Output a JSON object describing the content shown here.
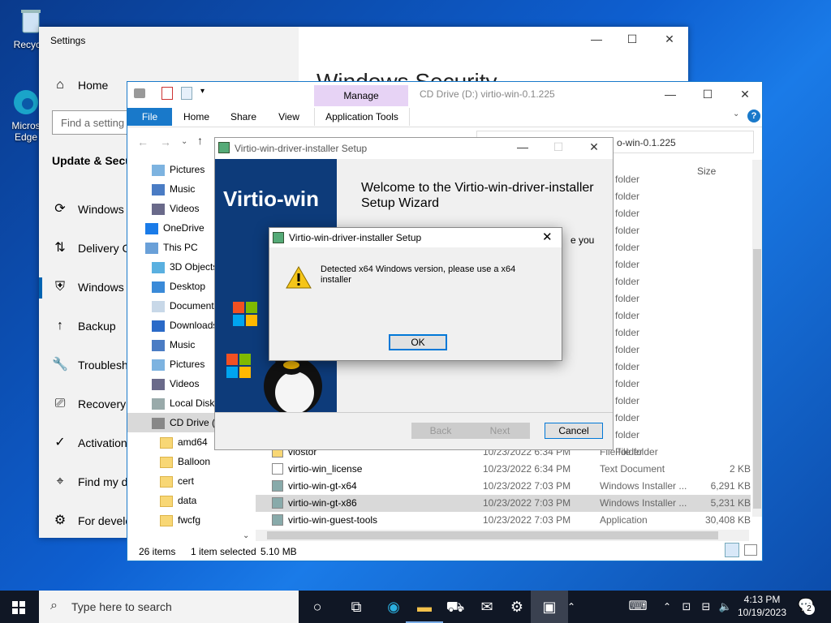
{
  "desktop": {
    "icons": [
      {
        "label": "Recycle"
      },
      {
        "label": "Micros Edge"
      }
    ]
  },
  "settings": {
    "window_title": "Settings",
    "search_placeholder": "Find a setting",
    "section_title": "Update & Secu",
    "home_label": "Home",
    "header_partial": "Windows Security",
    "nav": [
      {
        "icon": "sync-icon",
        "label": "Windows"
      },
      {
        "icon": "delivery-icon",
        "label": "Delivery C"
      },
      {
        "icon": "shield-icon",
        "label": "Windows"
      },
      {
        "icon": "backup-icon",
        "label": "Backup"
      },
      {
        "icon": "wrench-icon",
        "label": "Troublesh"
      },
      {
        "icon": "recovery-icon",
        "label": "Recovery"
      },
      {
        "icon": "check-circle-icon",
        "label": "Activation"
      },
      {
        "icon": "find-device-icon",
        "label": "Find my d"
      },
      {
        "icon": "developer-icon",
        "label": "For develo"
      }
    ]
  },
  "explorer": {
    "title": "CD Drive (D:) virtio-win-0.1.225",
    "manage_label": "Manage",
    "tabs": [
      "File",
      "Home",
      "Share",
      "View",
      "Application Tools"
    ],
    "address_tail": "o-win-0.1.225",
    "columns": {
      "size": "Size"
    },
    "tree": [
      {
        "icon": "pictures-icon",
        "label": "Pictures",
        "indent": 1
      },
      {
        "icon": "music-icon",
        "label": "Music",
        "indent": 1
      },
      {
        "icon": "videos-icon",
        "label": "Videos",
        "indent": 1
      },
      {
        "icon": "onedrive-icon",
        "label": "OneDrive",
        "indent": 0
      },
      {
        "icon": "thispc-icon",
        "label": "This PC",
        "indent": 0
      },
      {
        "icon": "3dobjects-icon",
        "label": "3D Objects",
        "indent": 1
      },
      {
        "icon": "desktop-icon",
        "label": "Desktop",
        "indent": 1
      },
      {
        "icon": "documents-icon",
        "label": "Documents",
        "indent": 1
      },
      {
        "icon": "downloads-icon",
        "label": "Downloads",
        "indent": 1
      },
      {
        "icon": "music-icon",
        "label": "Music",
        "indent": 1
      },
      {
        "icon": "pictures-icon",
        "label": "Pictures",
        "indent": 1
      },
      {
        "icon": "videos-icon",
        "label": "Videos",
        "indent": 1
      },
      {
        "icon": "localdisk-icon",
        "label": "Local Disk",
        "indent": 1
      },
      {
        "icon": "cddrive-icon",
        "label": "CD Drive (D",
        "indent": 1
      },
      {
        "icon": "folder-icon",
        "label": "amd64",
        "indent": 2
      },
      {
        "icon": "folder-icon",
        "label": "Balloon",
        "indent": 2
      },
      {
        "icon": "folder-icon",
        "label": "cert",
        "indent": 2
      },
      {
        "icon": "folder-icon",
        "label": "data",
        "indent": 2
      },
      {
        "icon": "folder-icon",
        "label": "fwcfg",
        "indent": 2
      }
    ],
    "folder_rows": [
      "folder",
      "folder",
      "folder",
      "folder",
      "folder",
      "folder",
      "folder",
      "folder",
      "folder",
      "folder",
      "folder",
      "folder",
      "folder",
      "folder",
      "folder",
      "folder",
      "File folder"
    ],
    "files": [
      {
        "name": "vlostor",
        "date": "10/23/2022 6:34 PM",
        "type": "File folder",
        "size": "",
        "icon": "folder-icon"
      },
      {
        "name": "virtio-win_license",
        "date": "10/23/2022 6:34 PM",
        "type": "Text Document",
        "size": "2 KB",
        "icon": "text-file-icon"
      },
      {
        "name": "virtio-win-gt-x64",
        "date": "10/23/2022 7:03 PM",
        "type": "Windows Installer ...",
        "size": "6,291 KB",
        "icon": "installer-icon"
      },
      {
        "name": "virtio-win-gt-x86",
        "date": "10/23/2022 7:03 PM",
        "type": "Windows Installer ...",
        "size": "5,231 KB",
        "icon": "installer-icon"
      },
      {
        "name": "virtio-win-guest-tools",
        "date": "10/23/2022 7:03 PM",
        "type": "Application",
        "size": "30,408 KB",
        "icon": "app-icon"
      }
    ],
    "status": {
      "items": "26 items",
      "selected": "1 item selected",
      "size": "5.10 MB"
    }
  },
  "installer": {
    "title": "Virtio-win-driver-installer Setup",
    "banner_text": "Virtio-win",
    "heading": "Welcome to the Virtio-win-driver-installer Setup Wizard",
    "body_partial": "e you",
    "back": "Back",
    "next": "Next",
    "cancel": "Cancel"
  },
  "modal": {
    "title": "Virtio-win-driver-installer Setup",
    "message": "Detected x64 Windows version, please use a x64 installer",
    "ok": "OK"
  },
  "taskbar": {
    "search_placeholder": "Type here to search",
    "time": "4:13 PM",
    "date": "10/19/2023",
    "notification_count": "2"
  },
  "colors": {
    "accent": "#0063b1",
    "manage_tab": "#e7d3f5",
    "installer_banner": "#0d3b7a",
    "selected_row": "#d9d9d9"
  }
}
